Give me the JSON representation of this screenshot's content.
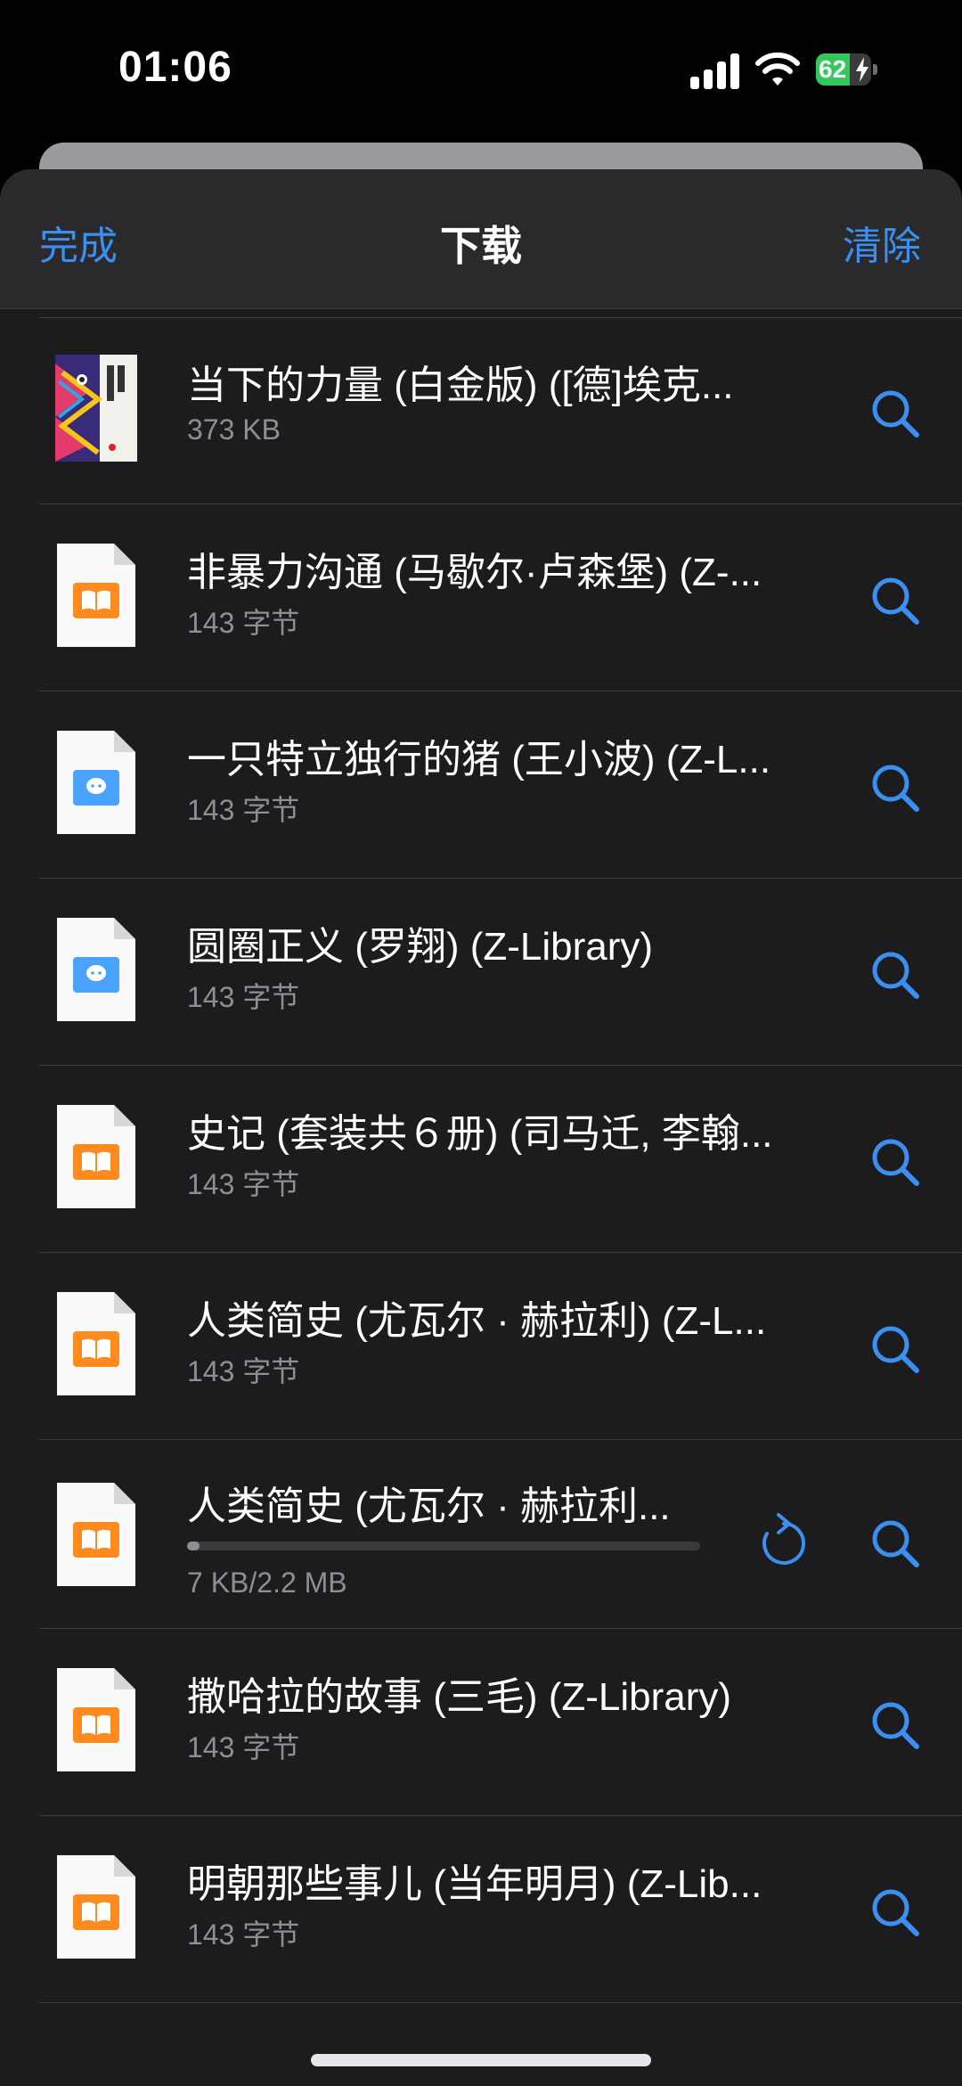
{
  "status_bar": {
    "time": "01:06",
    "battery": "62",
    "battery_level": 0.62,
    "icons": [
      "signal-icon",
      "wifi-icon",
      "battery-icon",
      "charging-bolt-icon"
    ]
  },
  "nav": {
    "done": "完成",
    "title": "下载",
    "clear": "清除"
  },
  "colors": {
    "accent": "#3b8ff0",
    "background": "#1c1c1e",
    "secondary_text": "#8e8e93",
    "book_orange": "#ff8a1e",
    "chat_blue": "#4aa3ff"
  },
  "items": [
    {
      "title": "当下的力量 (白金版) ([德]埃克...",
      "subtitle": "373 KB",
      "icon": "book-cover-thumbnail"
    },
    {
      "title": "非暴力沟通 (马歇尔·卢森堡) (Z-...",
      "subtitle": "143 字节",
      "icon": "books-file-icon"
    },
    {
      "title": "一只特立独行的猪 (王小波) (Z-L...",
      "subtitle": "143 字节",
      "icon": "chat-file-icon"
    },
    {
      "title": "圆圈正义 (罗翔) (Z-Library)",
      "subtitle": "143 字节",
      "icon": "chat-file-icon"
    },
    {
      "title": "史记 (套装共６册) (司马迁, 李翰...",
      "subtitle": "143 字节",
      "icon": "books-file-icon"
    },
    {
      "title": "人类简史 (尤瓦尔 · 赫拉利) (Z-L...",
      "subtitle": "143 字节",
      "icon": "books-file-icon"
    },
    {
      "title": "人类简史 (尤瓦尔 · 赫拉利...",
      "subtitle": "7 KB/2.2 MB",
      "icon": "books-file-icon",
      "downloading": true,
      "progress": 0.025
    },
    {
      "title": "撒哈拉的故事 (三毛) (Z-Library)",
      "subtitle": "143 字节",
      "icon": "books-file-icon"
    },
    {
      "title": "明朝那些事儿 (当年明月) (Z-Lib...",
      "subtitle": "143 字节",
      "icon": "books-file-icon"
    }
  ]
}
